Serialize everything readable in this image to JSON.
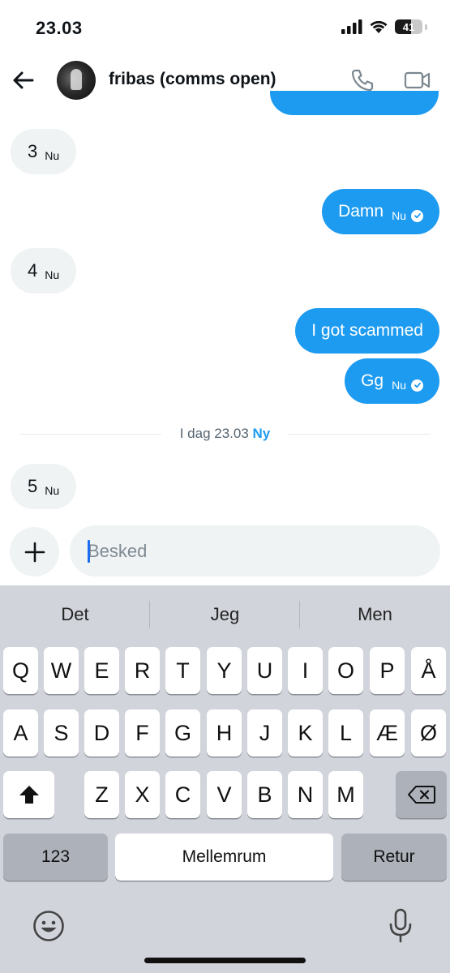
{
  "status_bar": {
    "time": "23.03",
    "battery": "41"
  },
  "header": {
    "title": "fribas (comms open)"
  },
  "messages": [
    {
      "dir": "in",
      "text": "3",
      "time": "Nu"
    },
    {
      "dir": "out",
      "text": "Damn",
      "time": "Nu",
      "read": true
    },
    {
      "dir": "in",
      "text": "4",
      "time": "Nu"
    },
    {
      "dir": "out",
      "text": "I got scammed"
    },
    {
      "dir": "out",
      "text": "Gg",
      "time": "Nu",
      "read": true
    },
    {
      "dir": "in",
      "text": "5",
      "time": "Nu"
    }
  ],
  "divider": {
    "text": "I dag 23.03",
    "badge": "Ny"
  },
  "composer": {
    "placeholder": "Besked",
    "value": ""
  },
  "keyboard": {
    "suggestions": [
      "Det",
      "Jeg",
      "Men"
    ],
    "row1": [
      "Q",
      "W",
      "E",
      "R",
      "T",
      "Y",
      "U",
      "I",
      "O",
      "P",
      "Å"
    ],
    "row2": [
      "A",
      "S",
      "D",
      "F",
      "G",
      "H",
      "J",
      "K",
      "L",
      "Æ",
      "Ø"
    ],
    "row3": [
      "Z",
      "X",
      "C",
      "V",
      "B",
      "N",
      "M"
    ],
    "numbers_key": "123",
    "space_key": "Mellemrum",
    "return_key": "Retur"
  },
  "colors": {
    "accent": "#1d9bf0",
    "incoming_bubble": "#eff3f4",
    "keyboard_bg": "#d1d4db"
  }
}
